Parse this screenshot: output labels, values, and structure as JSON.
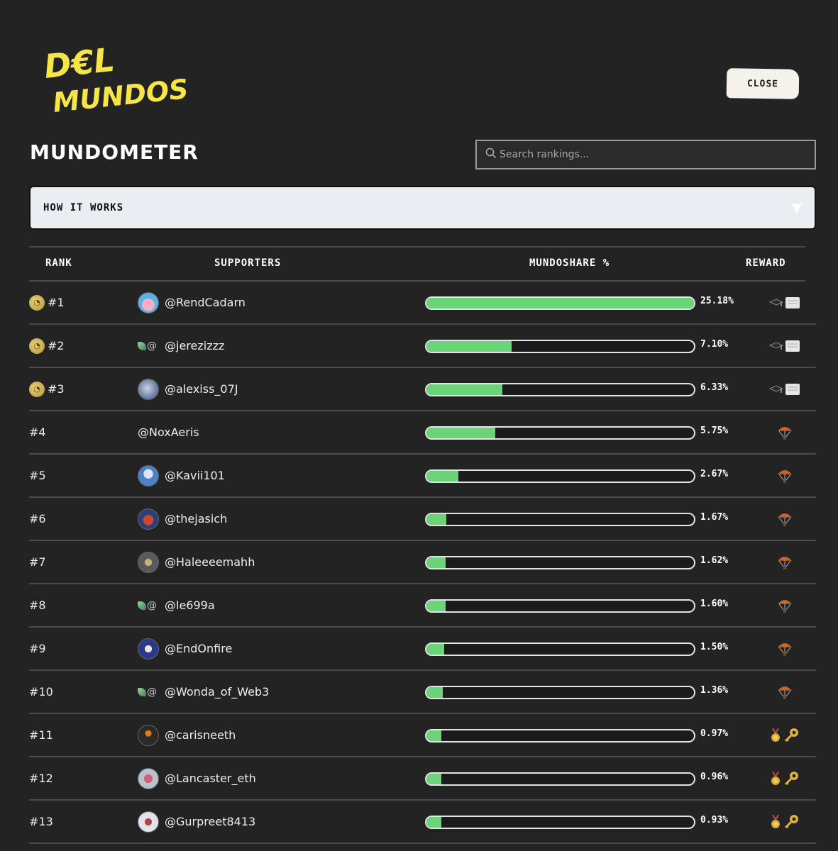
{
  "header": {
    "logo_line1": "D€L",
    "logo_line2": "MUNDOS",
    "close_label": "CLOSE"
  },
  "page": {
    "title": "MUNDOMETER",
    "search_placeholder": "Search rankings...",
    "how_it_works": "HOW IT WORKS"
  },
  "table": {
    "headers": [
      "RANK",
      "SUPPORTERS",
      "MUNDOSHARE %",
      "REWARD"
    ],
    "rows": [
      {
        "rank": "#1",
        "medal": true,
        "handle": "@RendCadarn",
        "avatar": "avatar-pig",
        "share": 25.18,
        "share_label": "25.18%",
        "reward": "graduate-scroll-icon"
      },
      {
        "rank": "#2",
        "medal": true,
        "handle": "@jerezizzz",
        "avatar": "broken",
        "share": 7.1,
        "share_label": "7.10%",
        "reward": "graduate-scroll-icon"
      },
      {
        "rank": "#3",
        "medal": true,
        "handle": "@alexiss_07J",
        "avatar": "avatar-robot",
        "share": 6.33,
        "share_label": "6.33%",
        "reward": "graduate-scroll-icon"
      },
      {
        "rank": "#4",
        "medal": false,
        "handle": "@NoxAeris",
        "avatar": "none",
        "share": 5.75,
        "share_label": "5.75%",
        "reward": "parachute-icon"
      },
      {
        "rank": "#5",
        "medal": false,
        "handle": "@Kavii101",
        "avatar": "avatar-blue",
        "share": 2.67,
        "share_label": "2.67%",
        "reward": "parachute-icon"
      },
      {
        "rank": "#6",
        "medal": false,
        "handle": "@thejasich",
        "avatar": "avatar-red",
        "share": 1.67,
        "share_label": "1.67%",
        "reward": "parachute-icon"
      },
      {
        "rank": "#7",
        "medal": false,
        "handle": "@Haleeeemahh",
        "avatar": "avatar-grey",
        "share": 1.62,
        "share_label": "1.62%",
        "reward": "parachute-icon"
      },
      {
        "rank": "#8",
        "medal": false,
        "handle": "@le699a",
        "avatar": "broken",
        "share": 1.6,
        "share_label": "1.60%",
        "reward": "parachute-icon"
      },
      {
        "rank": "#9",
        "medal": false,
        "handle": "@EndOnfire",
        "avatar": "avatar-navy",
        "share": 1.5,
        "share_label": "1.50%",
        "reward": "parachute-icon"
      },
      {
        "rank": "#10",
        "medal": false,
        "handle": "@Wonda_of_Web3",
        "avatar": "broken",
        "share": 1.36,
        "share_label": "1.36%",
        "reward": "parachute-icon"
      },
      {
        "rank": "#11",
        "medal": false,
        "handle": "@carisneeth",
        "avatar": "avatar-dark",
        "share": 0.97,
        "share_label": "0.97%",
        "reward": "medal-key-icon"
      },
      {
        "rank": "#12",
        "medal": false,
        "handle": "@Lancaster_eth",
        "avatar": "avatar-pink",
        "share": 0.96,
        "share_label": "0.96%",
        "reward": "medal-key-icon"
      },
      {
        "rank": "#13",
        "medal": false,
        "handle": "@Gurpreet8413",
        "avatar": "avatar-light",
        "share": 0.93,
        "share_label": "0.93%",
        "reward": "medal-key-icon"
      }
    ]
  },
  "colors": {
    "background": "#232323",
    "logo": "#f5e546",
    "bar_fill": "#6bd478",
    "panel": "#e9eef2"
  }
}
